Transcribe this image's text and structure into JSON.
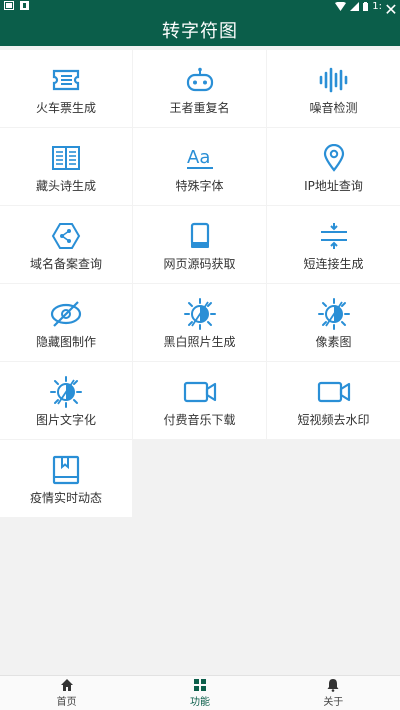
{
  "status": {
    "time": "1:"
  },
  "appbar": {
    "title": "转字符图"
  },
  "tools": [
    {
      "label": "火车票生成",
      "icon": "ticket-icon"
    },
    {
      "label": "王者重复名",
      "icon": "game-controller-icon"
    },
    {
      "label": "噪音检测",
      "icon": "audio-wave-icon"
    },
    {
      "label": "藏头诗生成",
      "icon": "book-icon"
    },
    {
      "label": "特殊字体",
      "icon": "font-aa-icon"
    },
    {
      "label": "IP地址查询",
      "icon": "location-pin-icon"
    },
    {
      "label": "域名备案查询",
      "icon": "share-network-icon"
    },
    {
      "label": "网页源码获取",
      "icon": "usb-drive-icon"
    },
    {
      "label": "短连接生成",
      "icon": "compress-icon"
    },
    {
      "label": "隐藏图制作",
      "icon": "hidden-eye-icon"
    },
    {
      "label": "黑白照片生成",
      "icon": "brightness-icon"
    },
    {
      "label": "像素图",
      "icon": "brightness-icon"
    },
    {
      "label": "图片文字化",
      "icon": "brightness-icon"
    },
    {
      "label": "付费音乐下载",
      "icon": "video-camera-icon"
    },
    {
      "label": "短视频去水印",
      "icon": "video-camera-icon"
    },
    {
      "label": "疫情实时动态",
      "icon": "bookmark-book-icon"
    }
  ],
  "bottom_nav": [
    {
      "label": "首页",
      "icon": "home-icon",
      "active": false
    },
    {
      "label": "功能",
      "icon": "grid-icon",
      "active": true
    },
    {
      "label": "关于",
      "icon": "bell-icon",
      "active": false
    }
  ],
  "colors": {
    "primary": "#0b5e4a",
    "icon": "#2a8fd6"
  }
}
